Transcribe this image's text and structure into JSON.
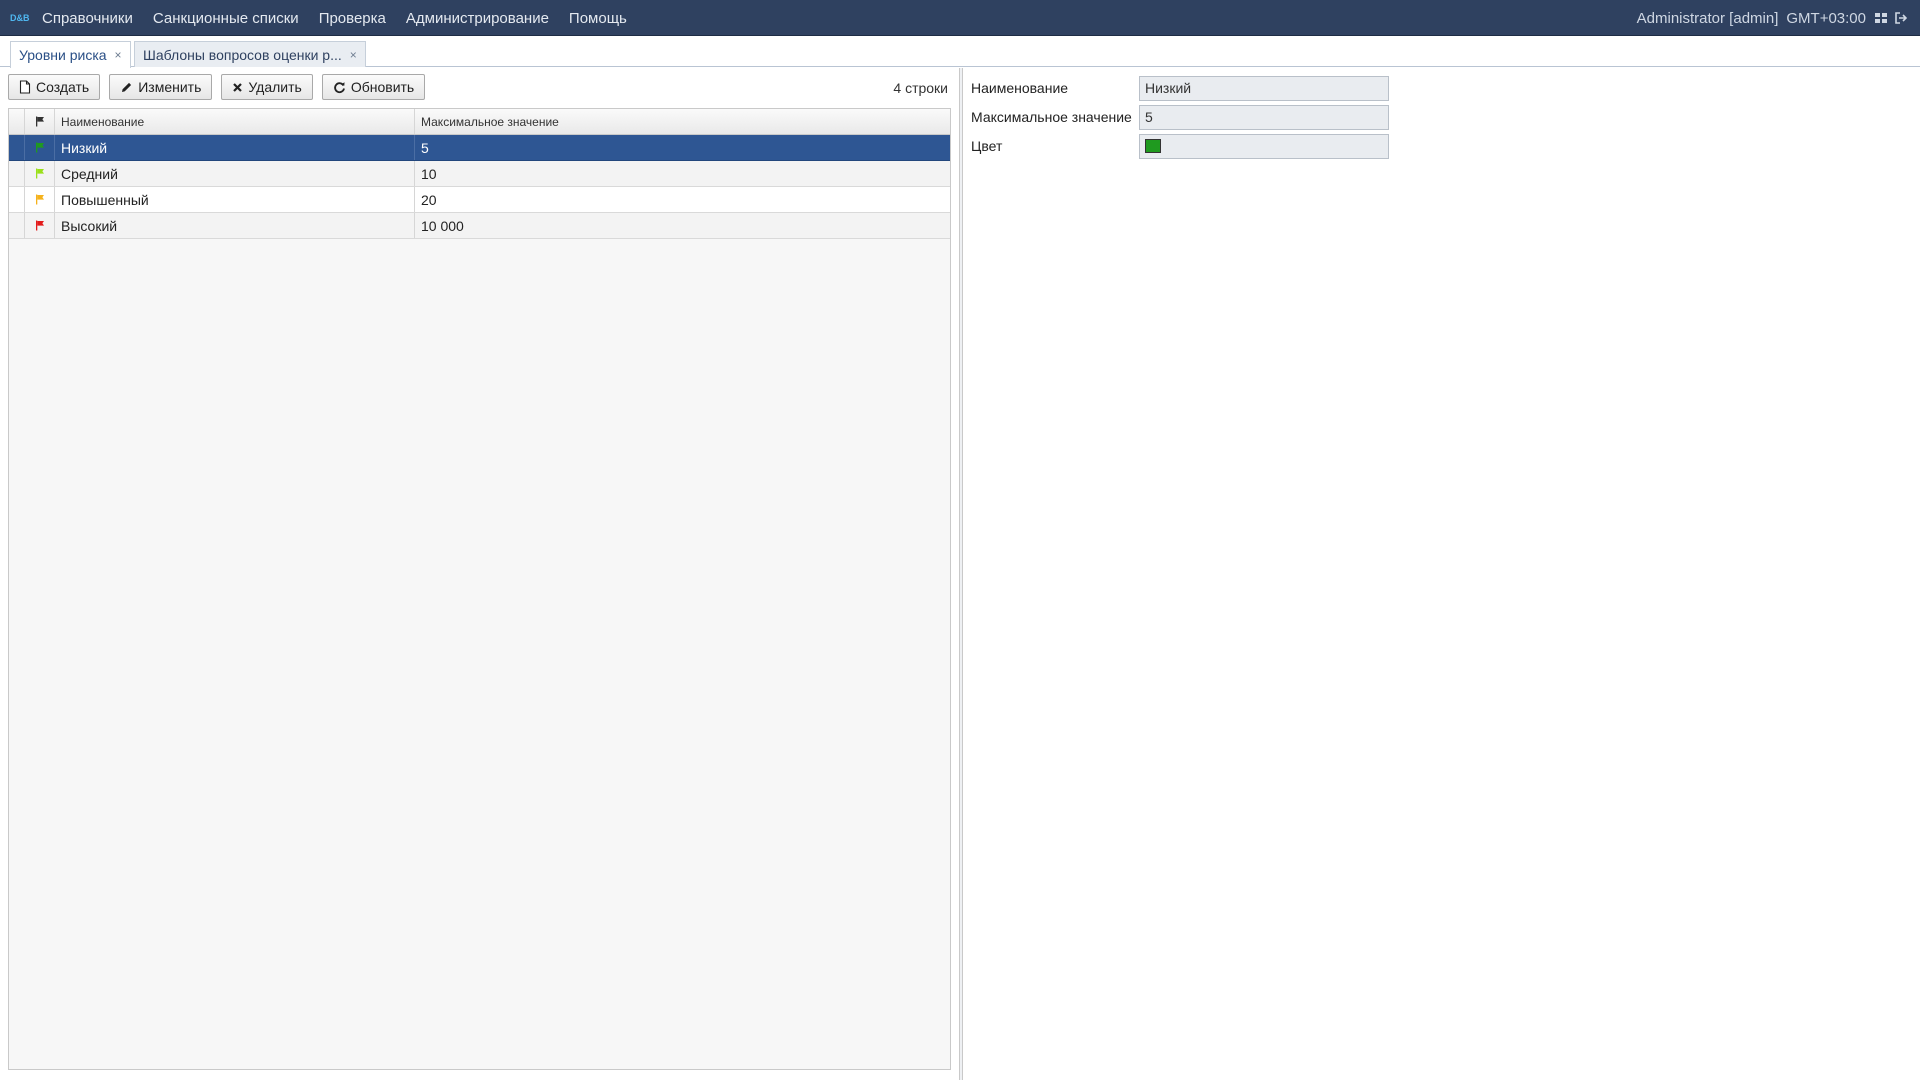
{
  "app": {
    "logo_text": "D&B"
  },
  "menu": [
    "Справочники",
    "Санкционные списки",
    "Проверка",
    "Администрирование",
    "Помощь"
  ],
  "user": {
    "name": "Administrator [admin]",
    "timezone": "GMT+03:00"
  },
  "tabs": [
    {
      "label": "Уровни риска",
      "close": "×",
      "active": true
    },
    {
      "label": "Шаблоны вопросов оценки р...",
      "close": "×",
      "active": false
    }
  ],
  "toolbar": {
    "create": "Создать",
    "edit": "Изменить",
    "delete": "Удалить",
    "refresh": "Обновить"
  },
  "row_count": "4 строки",
  "table": {
    "columns": [
      "Наименование",
      "Максимальное значение"
    ],
    "rows": [
      {
        "name": "Низкий",
        "max": "5",
        "flag_color": "#1f9a1f",
        "selected": true
      },
      {
        "name": "Средний",
        "max": "10",
        "flag_color": "#9ae01a",
        "selected": false
      },
      {
        "name": "Повышенный",
        "max": "20",
        "flag_color": "#f5b21c",
        "selected": false
      },
      {
        "name": "Высокий",
        "max": "10 000",
        "flag_color": "#e31b1b",
        "selected": false
      }
    ]
  },
  "details": {
    "name_label": "Наименование",
    "name_value": "Низкий",
    "max_label": "Максимальное значение",
    "max_value": "5",
    "color_label": "Цвет",
    "color_value": "#1f9a1f"
  },
  "colors": {
    "topbar": "#2f4160",
    "selection": "#2e5693",
    "logo": "#4fb7f0"
  }
}
